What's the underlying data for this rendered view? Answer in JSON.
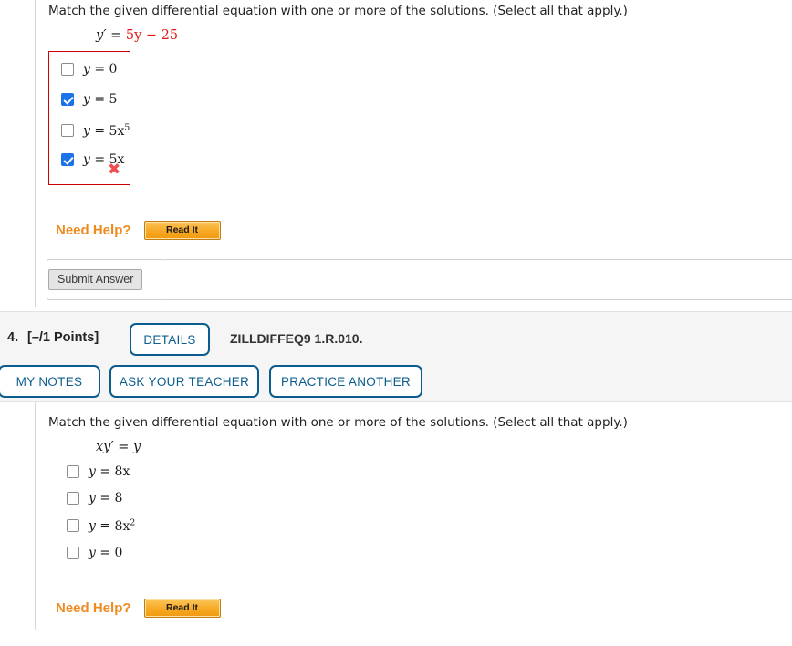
{
  "questions": [
    {
      "id": "q3",
      "prompt": "Match the given differential equation with one or more of the solutions. (Select all that apply.)",
      "equation": {
        "lhs": "y′ = ",
        "rhs": "5y − 25"
      },
      "options": [
        {
          "label": "y = 0",
          "base": "y = ",
          "value": "0",
          "exponent": "",
          "checked": false
        },
        {
          "label": "y = 5",
          "base": "y = ",
          "value": "5",
          "exponent": "",
          "checked": true
        },
        {
          "label": "y = 5x5",
          "base": "y = ",
          "value": "5x",
          "exponent": "5",
          "checked": false
        },
        {
          "label": "y = 5x",
          "base": "y = ",
          "value": "5x",
          "exponent": "",
          "checked": true
        }
      ],
      "result_mark": "✖",
      "need_help_label": "Need Help?",
      "read_it_label": "Read It",
      "submit_label": "Submit Answer"
    },
    {
      "id": "q4",
      "number": "4.",
      "points": "[–/1 Points]",
      "details_label": "DETAILS",
      "code": "ZILLDIFFEQ9 1.R.010.",
      "actions": [
        {
          "label": "MY NOTES"
        },
        {
          "label": "ASK YOUR TEACHER"
        },
        {
          "label": "PRACTICE ANOTHER"
        }
      ],
      "prompt": "Match the given differential equation with one or more of the solutions. (Select all that apply.)",
      "equation": {
        "lhs": "xy′ = y",
        "rhs": ""
      },
      "options": [
        {
          "label": "y = 8x",
          "base": "y = ",
          "value": "8x",
          "exponent": "",
          "checked": false
        },
        {
          "label": "y = 8",
          "base": "y = ",
          "value": "8",
          "exponent": "",
          "checked": false
        },
        {
          "label": "y = 8x2",
          "base": "y = ",
          "value": "8x",
          "exponent": "2",
          "checked": false
        },
        {
          "label": "y = 0",
          "base": "y = ",
          "value": "0",
          "exponent": "",
          "checked": false
        }
      ],
      "need_help_label": "Need Help?",
      "read_it_label": "Read It"
    }
  ],
  "colors": {
    "accent_blue": "#0b5d8e",
    "orange": "#f08a1e",
    "red": "#d00000",
    "equation_red": "#e01b18",
    "header_bg": "#f5f5f5"
  }
}
